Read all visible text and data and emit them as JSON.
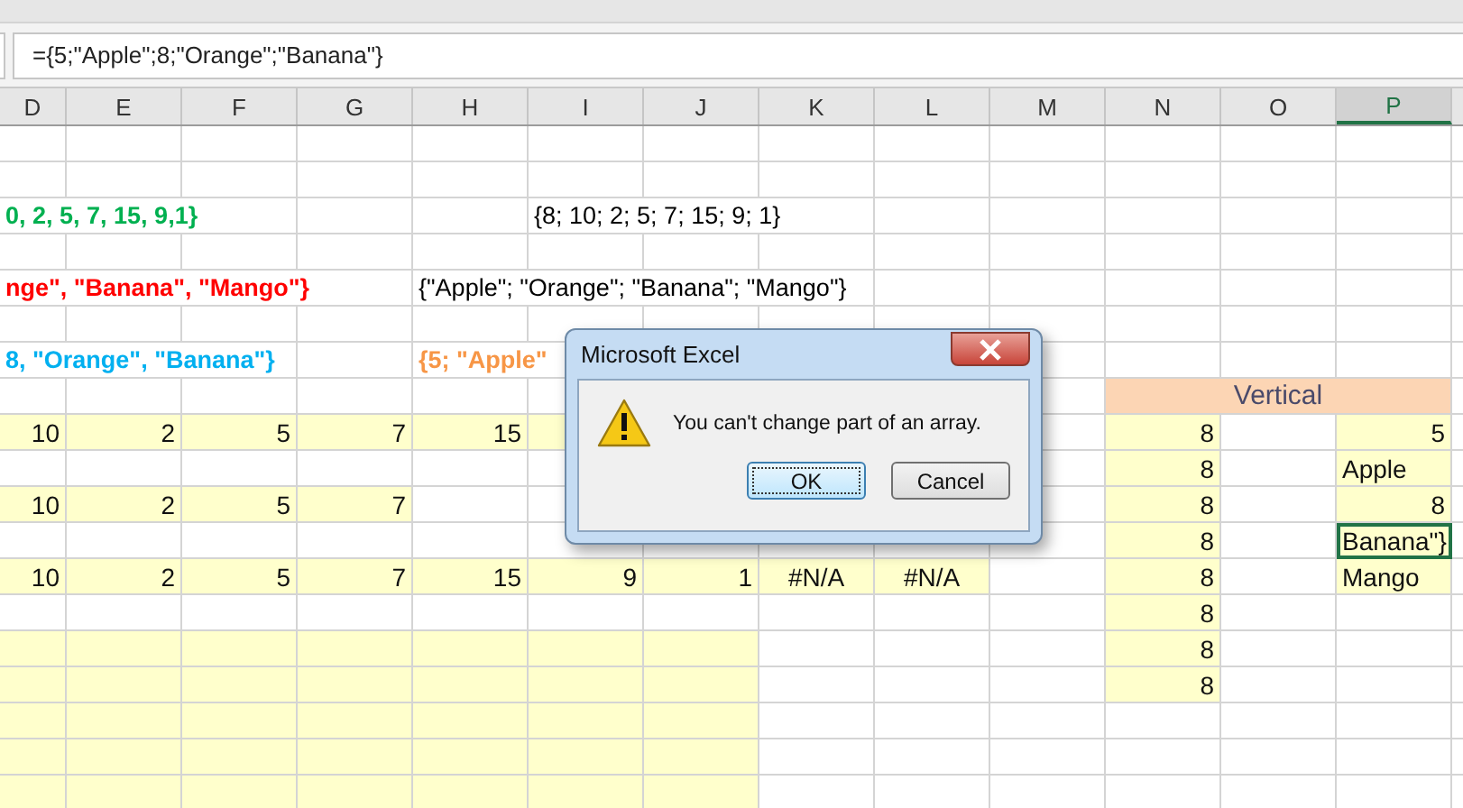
{
  "formula_bar": {
    "value": "={5;\"Apple\";8;\"Orange\";\"Banana\"}"
  },
  "columns": [
    {
      "label": "D",
      "selected": false
    },
    {
      "label": "E",
      "selected": false
    },
    {
      "label": "F",
      "selected": false
    },
    {
      "label": "G",
      "selected": false
    },
    {
      "label": "H",
      "selected": false
    },
    {
      "label": "I",
      "selected": false
    },
    {
      "label": "J",
      "selected": false
    },
    {
      "label": "K",
      "selected": false
    },
    {
      "label": "L",
      "selected": false
    },
    {
      "label": "M",
      "selected": false
    },
    {
      "label": "N",
      "selected": false
    },
    {
      "label": "O",
      "selected": false
    },
    {
      "label": "P",
      "selected": true
    }
  ],
  "rows": [
    [
      {
        "highlighted": false,
        "selected": false
      },
      {
        "highlighted": false,
        "selected": false
      },
      {
        "highlighted": false,
        "selected": false
      },
      {
        "highlighted": false,
        "selected": false
      },
      {
        "highlighted": false,
        "selected": false
      },
      {
        "highlighted": false,
        "selected": false
      },
      {
        "highlighted": false,
        "selected": false
      },
      {
        "highlighted": false,
        "selected": false
      },
      {
        "highlighted": false,
        "selected": false
      },
      {
        "highlighted": false,
        "selected": false
      },
      {
        "highlighted": false,
        "selected": false
      },
      {
        "highlighted": false,
        "selected": false
      },
      {
        "highlighted": false,
        "selected": false
      }
    ],
    [
      {
        "highlighted": false,
        "selected": false
      },
      {
        "highlighted": false,
        "selected": false
      },
      {
        "highlighted": false,
        "selected": false
      },
      {
        "highlighted": false,
        "selected": false
      },
      {
        "highlighted": false,
        "selected": false
      },
      {
        "highlighted": false,
        "selected": false
      },
      {
        "highlighted": false,
        "selected": false
      },
      {
        "highlighted": false,
        "selected": false
      },
      {
        "highlighted": false,
        "selected": false
      },
      {
        "highlighted": false,
        "selected": false
      },
      {
        "highlighted": false,
        "selected": false
      },
      {
        "highlighted": false,
        "selected": false
      },
      {
        "highlighted": false,
        "selected": false
      }
    ],
    [
      {
        "highlighted": false,
        "selected": false,
        "text": "0, 2, 5, 7, 15, 9,1}",
        "kind": "overflow",
        "color": "#00b050"
      },
      {
        "highlighted": false,
        "selected": false
      },
      {
        "highlighted": false,
        "selected": false
      },
      {
        "highlighted": false,
        "selected": false,
        "text": "{8; 10; 2; 5; 7; 15; 9; 1}",
        "kind": "overflow",
        "color": "#000000"
      },
      {
        "highlighted": false,
        "selected": false
      },
      {
        "highlighted": false,
        "selected": false
      },
      {
        "highlighted": false,
        "selected": false
      },
      {
        "highlighted": false,
        "selected": false
      },
      {
        "highlighted": false,
        "selected": false
      }
    ],
    [
      {
        "highlighted": false,
        "selected": false
      },
      {
        "highlighted": false,
        "selected": false
      },
      {
        "highlighted": false,
        "selected": false
      },
      {
        "highlighted": false,
        "selected": false
      },
      {
        "highlighted": false,
        "selected": false
      },
      {
        "highlighted": false,
        "selected": false
      },
      {
        "highlighted": false,
        "selected": false
      },
      {
        "highlighted": false,
        "selected": false
      },
      {
        "highlighted": false,
        "selected": false
      },
      {
        "highlighted": false,
        "selected": false
      },
      {
        "highlighted": false,
        "selected": false
      },
      {
        "highlighted": false,
        "selected": false
      },
      {
        "highlighted": false,
        "selected": false
      }
    ],
    [
      {
        "highlighted": false,
        "selected": false,
        "text": "nge\", \"Banana\", \"Mango\"}",
        "kind": "overflow",
        "color": "#ff0000"
      },
      {
        "highlighted": false,
        "selected": false,
        "text": "{\"Apple\"; \"Orange\"; \"Banana\"; \"Mango\"}",
        "kind": "overflow",
        "color": "#000000"
      },
      {
        "highlighted": false,
        "selected": false
      },
      {
        "highlighted": false,
        "selected": false
      },
      {
        "highlighted": false,
        "selected": false
      },
      {
        "highlighted": false,
        "selected": false
      },
      {
        "highlighted": false,
        "selected": false
      }
    ],
    [
      {
        "highlighted": false,
        "selected": false
      },
      {
        "highlighted": false,
        "selected": false
      },
      {
        "highlighted": false,
        "selected": false
      },
      {
        "highlighted": false,
        "selected": false
      },
      {
        "highlighted": false,
        "selected": false
      },
      {
        "highlighted": false,
        "selected": false
      },
      {
        "highlighted": false,
        "selected": false
      },
      {
        "highlighted": false,
        "selected": false
      },
      {
        "highlighted": false,
        "selected": false
      },
      {
        "highlighted": false,
        "selected": false
      },
      {
        "highlighted": false,
        "selected": false
      },
      {
        "highlighted": false,
        "selected": false
      },
      {
        "highlighted": false,
        "selected": false
      }
    ],
    [
      {
        "highlighted": false,
        "selected": false,
        "text": "8, \"Orange\", \"Banana\"}",
        "kind": "overflow",
        "color": "#00b0f0"
      },
      {
        "highlighted": false,
        "selected": false
      },
      {
        "highlighted": false,
        "selected": false,
        "text": "{5; \"Apple\"",
        "kind": "overflow",
        "color": "#f79646"
      },
      {},
      {},
      {},
      {
        "highlighted": false,
        "selected": false
      },
      {
        "highlighted": false,
        "selected": false
      },
      {
        "highlighted": false,
        "selected": false
      },
      {
        "highlighted": false,
        "selected": false
      }
    ],
    [
      {
        "highlighted": false,
        "selected": false
      },
      {
        "highlighted": false,
        "selected": false
      },
      {
        "highlighted": false,
        "selected": false
      },
      {
        "highlighted": false,
        "selected": false
      },
      {
        "highlighted": false,
        "selected": false
      },
      {
        "highlighted": false,
        "selected": false
      },
      {},
      {},
      {},
      {
        "highlighted": false,
        "selected": false
      },
      {
        "highlighted": true,
        "selected": false,
        "text": "Vertical",
        "kind": "merged"
      }
    ],
    [
      {
        "highlighted": true,
        "selected": false,
        "text": "10",
        "kind": "number"
      },
      {
        "highlighted": true,
        "selected": false,
        "text": "2",
        "kind": "number"
      },
      {
        "highlighted": true,
        "selected": false,
        "text": "5",
        "kind": "number"
      },
      {
        "highlighted": true,
        "selected": false,
        "text": "7",
        "kind": "number"
      },
      {
        "highlighted": true,
        "selected": false,
        "text": "15",
        "kind": "number"
      },
      {
        "highlighted": true,
        "selected": false
      },
      {},
      {},
      {},
      {
        "highlighted": false,
        "selected": false
      },
      {
        "highlighted": true,
        "selected": false,
        "text": "8",
        "kind": "number"
      },
      {
        "highlighted": false,
        "selected": false
      },
      {
        "highlighted": true,
        "selected": false,
        "text": "5",
        "kind": "number"
      }
    ],
    [
      {
        "highlighted": false,
        "selected": false
      },
      {
        "highlighted": false,
        "selected": false
      },
      {
        "highlighted": false,
        "selected": false
      },
      {
        "highlighted": false,
        "selected": false
      },
      {
        "highlighted": false,
        "selected": false
      },
      {
        "highlighted": false,
        "selected": false
      },
      {},
      {},
      {},
      {
        "highlighted": false,
        "selected": false
      },
      {
        "highlighted": true,
        "selected": false,
        "text": "8",
        "kind": "number"
      },
      {
        "highlighted": false,
        "selected": false
      },
      {
        "highlighted": true,
        "selected": false,
        "text": "Apple",
        "kind": "text"
      }
    ],
    [
      {
        "highlighted": true,
        "selected": false,
        "text": "10",
        "kind": "number"
      },
      {
        "highlighted": true,
        "selected": false,
        "text": "2",
        "kind": "number"
      },
      {
        "highlighted": true,
        "selected": false,
        "text": "5",
        "kind": "number"
      },
      {
        "highlighted": true,
        "selected": false,
        "text": "7",
        "kind": "number"
      },
      {
        "highlighted": false,
        "selected": false
      },
      {
        "highlighted": false,
        "selected": false
      },
      {},
      {},
      {},
      {
        "highlighted": false,
        "selected": false
      },
      {
        "highlighted": true,
        "selected": false,
        "text": "8",
        "kind": "number"
      },
      {
        "highlighted": false,
        "selected": false
      },
      {
        "highlighted": true,
        "selected": false,
        "text": "8",
        "kind": "number"
      }
    ],
    [
      {
        "highlighted": false,
        "selected": false
      },
      {
        "highlighted": false,
        "selected": false
      },
      {
        "highlighted": false,
        "selected": false
      },
      {
        "highlighted": false,
        "selected": false
      },
      {
        "highlighted": false,
        "selected": false
      },
      {
        "highlighted": false,
        "selected": false
      },
      {
        "highlighted": false,
        "selected": false
      },
      {
        "highlighted": false,
        "selected": false
      },
      {
        "highlighted": false,
        "selected": false
      },
      {
        "highlighted": false,
        "selected": false
      },
      {
        "highlighted": true,
        "selected": false,
        "text": "8",
        "kind": "number"
      },
      {
        "highlighted": false,
        "selected": false
      },
      {
        "highlighted": true,
        "selected": true,
        "text": "Banana\"}",
        "kind": "text"
      }
    ],
    [
      {
        "highlighted": true,
        "selected": false,
        "text": "10",
        "kind": "number"
      },
      {
        "highlighted": true,
        "selected": false,
        "text": "2",
        "kind": "number"
      },
      {
        "highlighted": true,
        "selected": false,
        "text": "5",
        "kind": "number"
      },
      {
        "highlighted": true,
        "selected": false,
        "text": "7",
        "kind": "number"
      },
      {
        "highlighted": true,
        "selected": false,
        "text": "15",
        "kind": "number"
      },
      {
        "highlighted": true,
        "selected": false,
        "text": "9",
        "kind": "number"
      },
      {
        "highlighted": true,
        "selected": false,
        "text": "1",
        "kind": "number"
      },
      {
        "highlighted": true,
        "selected": false,
        "text": "#N/A",
        "kind": "error"
      },
      {
        "highlighted": true,
        "selected": false,
        "text": "#N/A",
        "kind": "error"
      },
      {
        "highlighted": false,
        "selected": false
      },
      {
        "highlighted": true,
        "selected": false,
        "text": "8",
        "kind": "number"
      },
      {
        "highlighted": false,
        "selected": false
      },
      {
        "highlighted": true,
        "selected": false,
        "text": "Mango",
        "kind": "text"
      }
    ],
    [
      {
        "highlighted": false,
        "selected": false
      },
      {
        "highlighted": false,
        "selected": false
      },
      {
        "highlighted": false,
        "selected": false
      },
      {
        "highlighted": false,
        "selected": false
      },
      {
        "highlighted": false,
        "selected": false
      },
      {
        "highlighted": false,
        "selected": false
      },
      {
        "highlighted": false,
        "selected": false
      },
      {
        "highlighted": false,
        "selected": false
      },
      {
        "highlighted": false,
        "selected": false
      },
      {
        "highlighted": false,
        "selected": false
      },
      {
        "highlighted": true,
        "selected": false,
        "text": "8",
        "kind": "number"
      },
      {
        "highlighted": false,
        "selected": false
      },
      {
        "highlighted": false,
        "selected": false
      }
    ],
    [
      {
        "highlighted": true,
        "selected": false
      },
      {
        "highlighted": true,
        "selected": false
      },
      {
        "highlighted": true,
        "selected": false
      },
      {
        "highlighted": true,
        "selected": false
      },
      {
        "highlighted": true,
        "selected": false
      },
      {
        "highlighted": true,
        "selected": false
      },
      {
        "highlighted": true,
        "selected": false
      },
      {
        "highlighted": false,
        "selected": false
      },
      {
        "highlighted": false,
        "selected": false
      },
      {
        "highlighted": false,
        "selected": false
      },
      {
        "highlighted": true,
        "selected": false,
        "text": "8",
        "kind": "number"
      },
      {
        "highlighted": false,
        "selected": false
      },
      {
        "highlighted": false,
        "selected": false
      }
    ],
    [
      {
        "highlighted": true,
        "selected": false
      },
      {
        "highlighted": true,
        "selected": false
      },
      {
        "highlighted": true,
        "selected": false
      },
      {
        "highlighted": true,
        "selected": false
      },
      {
        "highlighted": true,
        "selected": false
      },
      {
        "highlighted": true,
        "selected": false
      },
      {
        "highlighted": true,
        "selected": false
      },
      {
        "highlighted": false,
        "selected": false
      },
      {
        "highlighted": false,
        "selected": false
      },
      {
        "highlighted": false,
        "selected": false
      },
      {
        "highlighted": true,
        "selected": false,
        "text": "8",
        "kind": "number"
      },
      {
        "highlighted": false,
        "selected": false
      },
      {
        "highlighted": false,
        "selected": false
      }
    ],
    [
      {
        "highlighted": true,
        "selected": false
      },
      {
        "highlighted": true,
        "selected": false
      },
      {
        "highlighted": true,
        "selected": false
      },
      {
        "highlighted": true,
        "selected": false
      },
      {
        "highlighted": true,
        "selected": false
      },
      {
        "highlighted": true,
        "selected": false
      },
      {
        "highlighted": true,
        "selected": false
      },
      {
        "highlighted": false,
        "selected": false
      },
      {
        "highlighted": false,
        "selected": false
      },
      {
        "highlighted": false,
        "selected": false
      },
      {
        "highlighted": false,
        "selected": false
      },
      {
        "highlighted": false,
        "selected": false
      },
      {
        "highlighted": false,
        "selected": false
      }
    ],
    [
      {
        "highlighted": true,
        "selected": false
      },
      {
        "highlighted": true,
        "selected": false
      },
      {
        "highlighted": true,
        "selected": false
      },
      {
        "highlighted": true,
        "selected": false
      },
      {
        "highlighted": true,
        "selected": false
      },
      {
        "highlighted": true,
        "selected": false
      },
      {
        "highlighted": true,
        "selected": false
      },
      {
        "highlighted": false,
        "selected": false
      },
      {
        "highlighted": false,
        "selected": false
      },
      {
        "highlighted": false,
        "selected": false
      },
      {
        "highlighted": false,
        "selected": false
      },
      {
        "highlighted": false,
        "selected": false
      },
      {
        "highlighted": false,
        "selected": false
      }
    ],
    [
      {
        "highlighted": true,
        "selected": false
      },
      {
        "highlighted": true,
        "selected": false
      },
      {
        "highlighted": true,
        "selected": false
      },
      {
        "highlighted": true,
        "selected": false
      },
      {
        "highlighted": true,
        "selected": false
      },
      {
        "highlighted": true,
        "selected": false
      },
      {
        "highlighted": true,
        "selected": false
      },
      {
        "highlighted": false,
        "selected": false
      },
      {
        "highlighted": false,
        "selected": false
      },
      {
        "highlighted": false,
        "selected": false
      },
      {
        "highlighted": false,
        "selected": false
      },
      {
        "highlighted": false,
        "selected": false
      },
      {
        "highlighted": false,
        "selected": false
      }
    ]
  ],
  "dialog": {
    "title": "Microsoft Excel",
    "message": "You can't change part of an array.",
    "buttons": [
      {
        "label": "OK",
        "selected": true
      },
      {
        "label": "Cancel",
        "selected": false
      }
    ]
  }
}
